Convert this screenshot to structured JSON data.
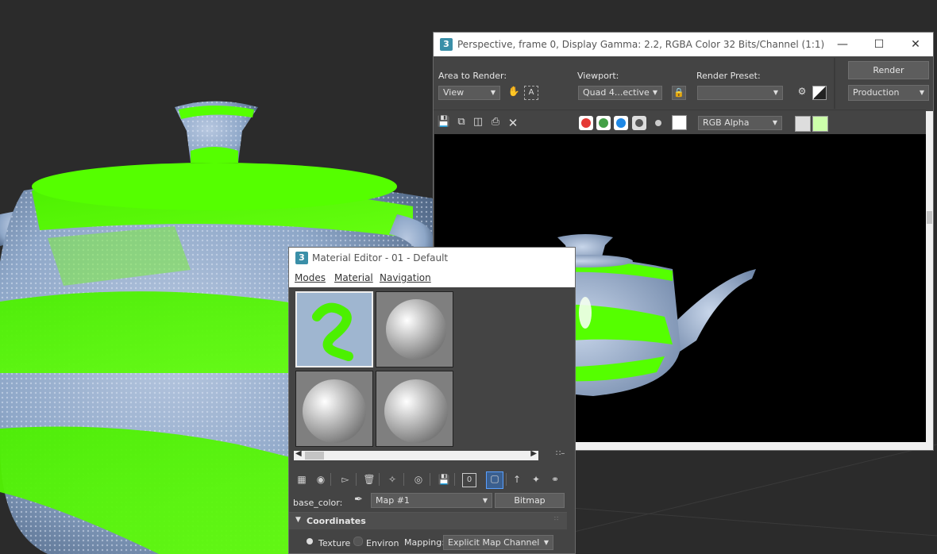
{
  "render_window": {
    "title": "Perspective, frame 0, Display Gamma: 2.2, RGBA Color 32 Bits/Channel (1:1)",
    "app_icon": "3",
    "controls": [
      "minimize-icon",
      "maximize-icon",
      "close-icon"
    ],
    "area_to_render": {
      "label": "Area to Render:",
      "value": "View"
    },
    "viewport": {
      "label": "Viewport:",
      "value": "Quad 4...ective"
    },
    "render_preset": {
      "label": "Render Preset:",
      "value": ""
    },
    "render_button": "Render",
    "production": "Production",
    "channel": "RGB Alpha",
    "channel_buttons": {
      "red": "#e53935",
      "green": "#43a047",
      "blue": "#1e88e5"
    },
    "toolbar_icons": [
      "save-icon",
      "copy-icon",
      "clone-icon",
      "print-icon",
      "clear-icon"
    ]
  },
  "material_editor": {
    "title": "Material Editor - 01 - Default",
    "app_icon": "3",
    "menu": [
      "Modes",
      "Material",
      "Navigation"
    ],
    "base_color_label": "base_color:",
    "map_value": "Map #1",
    "bitmap_button": "Bitmap",
    "rollout_title": "Coordinates",
    "texture_option": "Texture",
    "environ_option": "Environ",
    "mapping_label": "Mapping:",
    "mapping_value": "Explicit Map Channel"
  },
  "colors": {
    "accent_green": "#55ff00",
    "texture_blue": "#8ea7c8",
    "viewport_bg": "#2b2b2b"
  }
}
